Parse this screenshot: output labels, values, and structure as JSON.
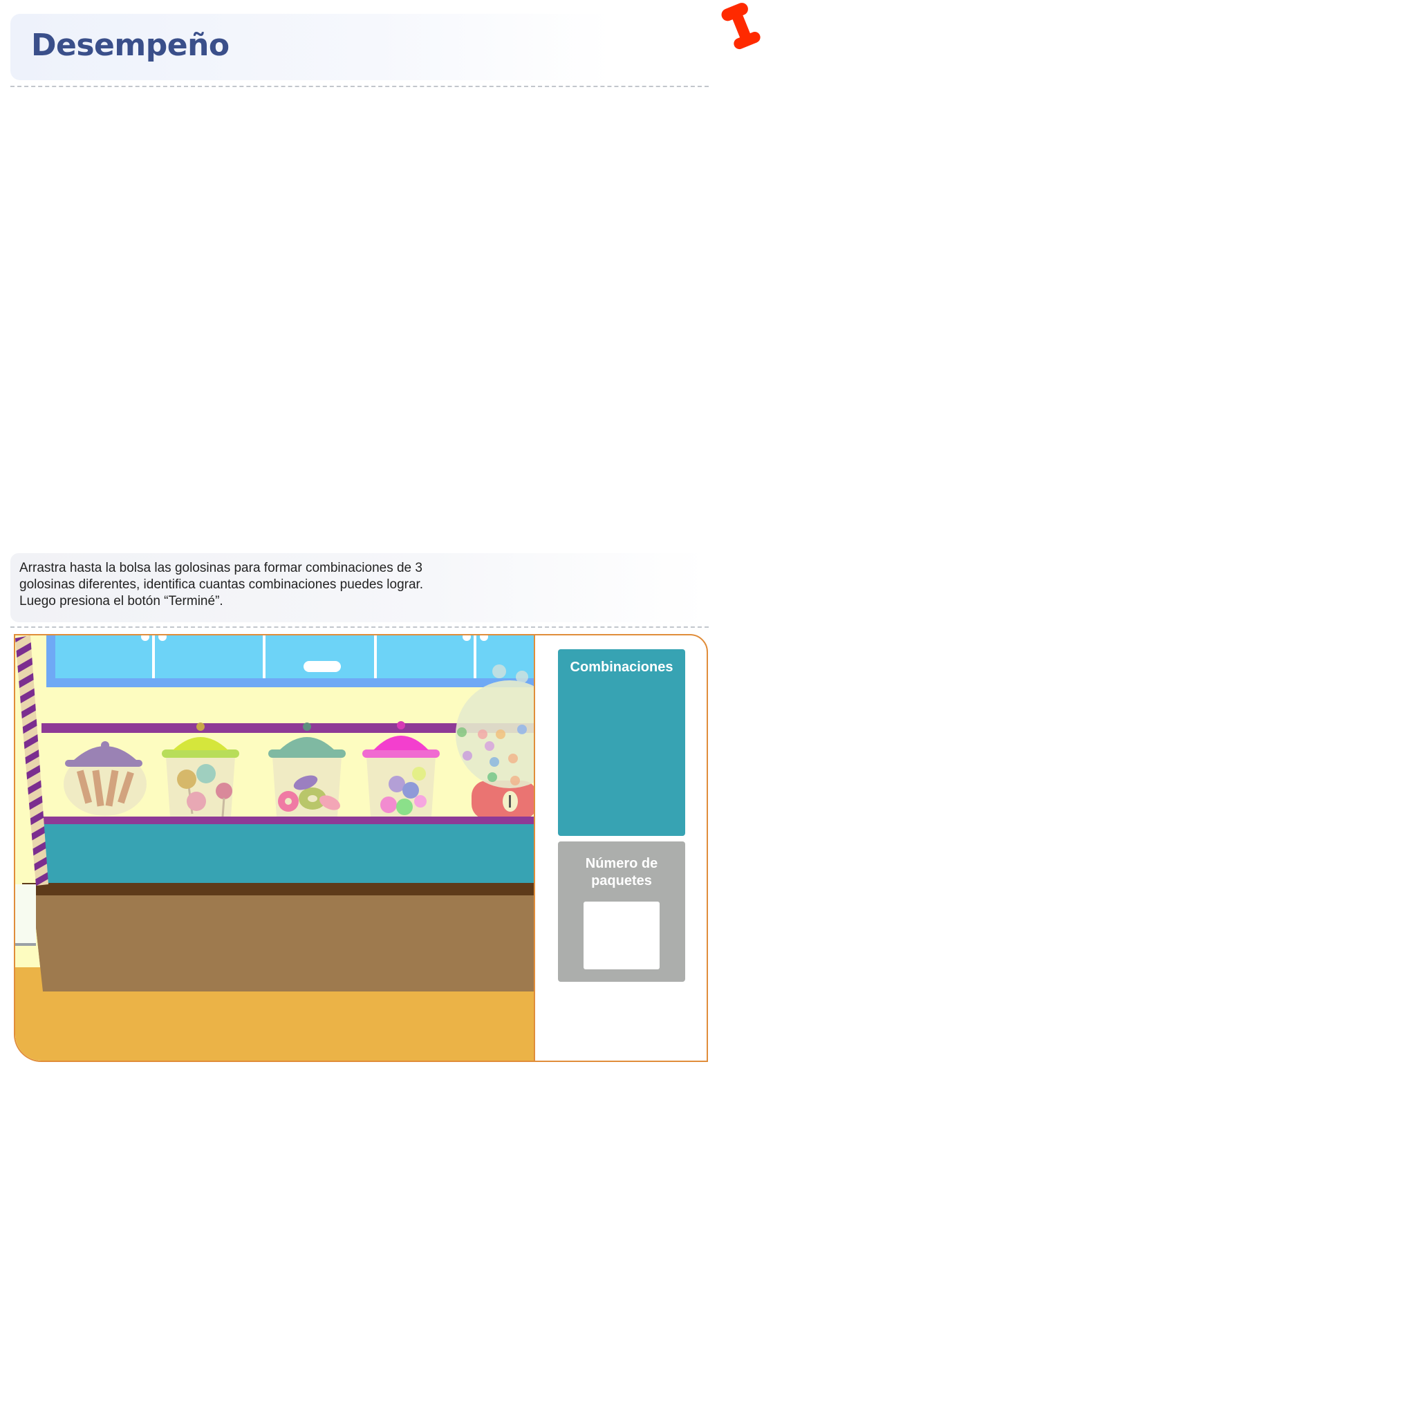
{
  "header": {
    "title": "Desempeño"
  },
  "instructions": {
    "line1": "Arrastra hasta la bolsa las golosinas para formar combinaciones de 3",
    "line2": "golosinas diferentes, identifica cuantas combinaciones puedes lograr.",
    "line3": "Luego presiona el botón “Terminé”."
  },
  "activity": {
    "combinations_label": "Combinaciones",
    "packages_label_line1": "Número de",
    "packages_label_line2": "paquetes",
    "packages_value": "",
    "candies": [
      "wafers",
      "lollipops",
      "donuts",
      "wrapped-candies",
      "gumball-machine"
    ]
  },
  "colors": {
    "title": "#3a4f8a",
    "combinations_panel": "#37a3b3",
    "packages_panel": "#acaeac",
    "frame_border": "#e08d3a",
    "pin": "#ff2a00"
  }
}
